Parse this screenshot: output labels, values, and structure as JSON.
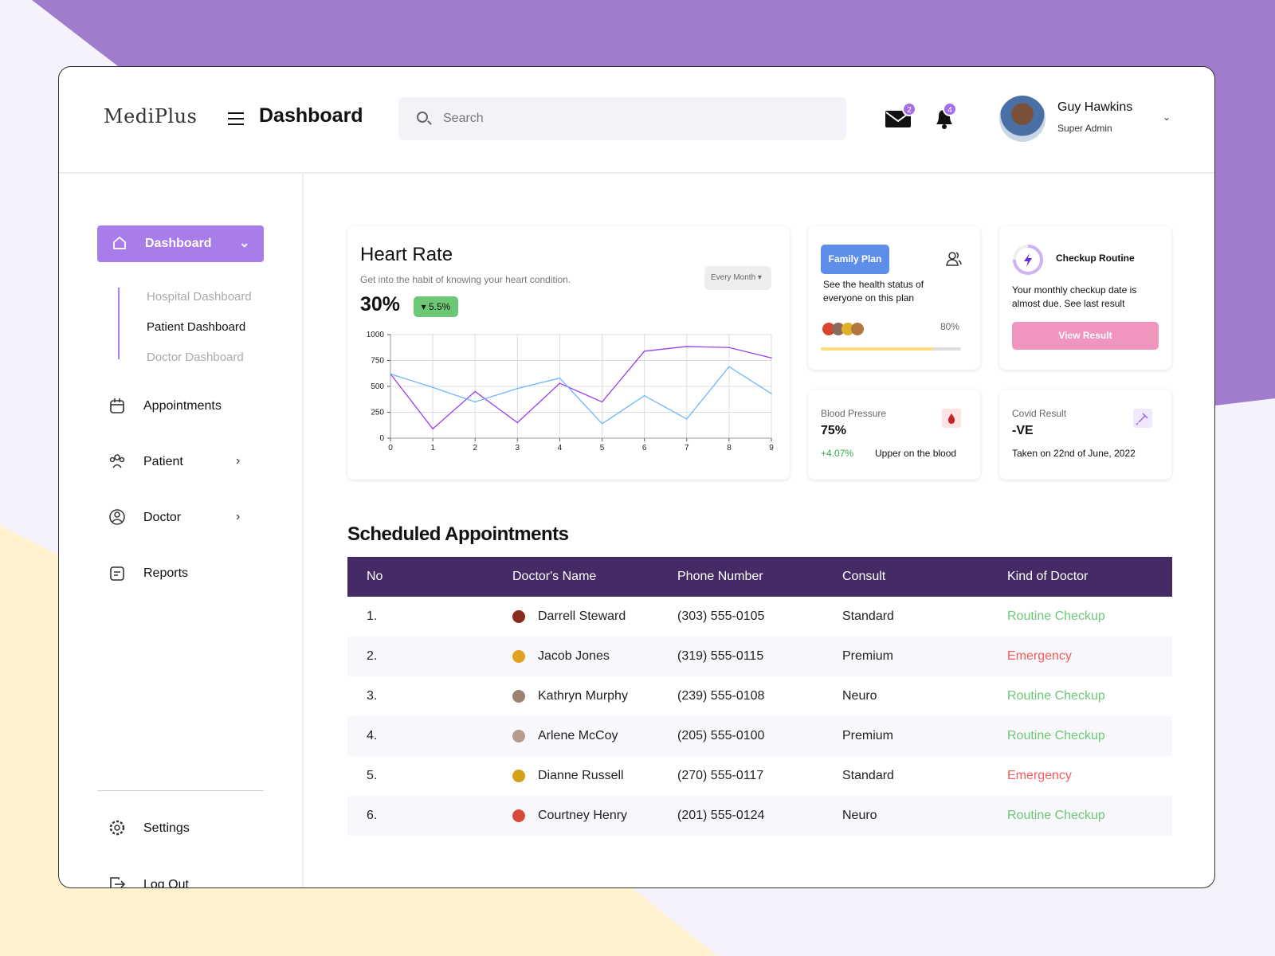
{
  "app": {
    "logo": "MediPlus",
    "page_title": "Dashboard"
  },
  "search": {
    "placeholder": "Search"
  },
  "header": {
    "mail_count": "2",
    "notif_count": "4",
    "user_name": "Guy Hawkins",
    "user_role": "Super Admin"
  },
  "sidebar": {
    "dashboard": "Dashboard",
    "sub": [
      "Hospital Dashboard",
      "Patient Dashboard",
      "Doctor Dashboard"
    ],
    "items": [
      "Appointments",
      "Patient",
      "Doctor",
      "Reports"
    ],
    "bottom": [
      "Settings",
      "Log Out"
    ]
  },
  "heart": {
    "title": "Heart Rate",
    "subtitle": "Get into the habit of knowing your heart condition.",
    "value": "30%",
    "change": "▾ 5.5%",
    "period": "Every Month"
  },
  "family": {
    "label": "Family Plan",
    "text1": "See the health status of",
    "text2": "everyone on this plan",
    "percent": "80%",
    "progress": 80
  },
  "checkup": {
    "title": "Checkup Routine",
    "text1": "Your monthly checkup date is",
    "text2": "almost due. See last  result",
    "button": "View Result"
  },
  "bp": {
    "title": "Blood Pressure",
    "value": "75%",
    "change": "+4.07%",
    "note": "Upper on the blood"
  },
  "covid": {
    "title": "Covid Result",
    "value": "-VE",
    "note": "Taken on 22nd of June, 2022"
  },
  "appointments": {
    "title": "Scheduled Appointments",
    "columns": [
      "No",
      "Doctor's Name",
      "Phone Number",
      "Consult",
      "Kind of Doctor"
    ],
    "rows": [
      [
        "1.",
        "Darrell Steward",
        "(303) 555-0105",
        "Standard",
        "Routine Checkup"
      ],
      [
        "2.",
        "Jacob Jones",
        "(319) 555-0115",
        "Premium",
        "Emergency"
      ],
      [
        "3.",
        "Kathryn Murphy",
        "(239) 555-0108",
        "Neuro",
        "Routine Checkup"
      ],
      [
        "4.",
        "Arlene McCoy",
        "(205) 555-0100",
        "Premium",
        "Routine Checkup"
      ],
      [
        "5.",
        "Dianne Russell",
        "(270) 555-0117",
        "Standard",
        "Emergency"
      ],
      [
        "6.",
        "Courtney Henry",
        "(201) 555-0124",
        "Neuro",
        "Routine Checkup"
      ]
    ]
  },
  "colors": {
    "accent": "#a77de9",
    "routine": "#6cc877",
    "emergency": "#f25c5c",
    "table_header": "#452b66"
  },
  "chart_data": {
    "type": "line",
    "x": [
      0,
      1,
      2,
      3,
      4,
      5,
      6,
      7,
      8,
      9
    ],
    "xlim": [
      0,
      9
    ],
    "ylim": [
      0,
      1000
    ],
    "yticks": [
      0,
      250,
      500,
      750,
      1000
    ],
    "grid": true,
    "series": [
      {
        "color": "#9b3ff0",
        "values": [
          620,
          90,
          450,
          150,
          530,
          350,
          840,
          885,
          875,
          775
        ]
      },
      {
        "color": "#6cb6ff",
        "values": [
          620,
          490,
          350,
          480,
          580,
          140,
          410,
          185,
          690,
          430
        ]
      }
    ]
  }
}
